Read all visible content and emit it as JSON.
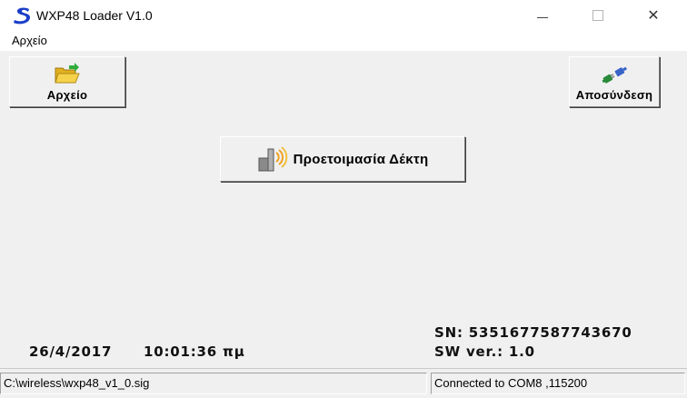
{
  "window": {
    "title": "WXP48 Loader V1.0",
    "app_icon": "s-logo-icon",
    "controls": {
      "minimize": "minimize-icon",
      "maximize": "maximize-icon",
      "close_glyph": "✕"
    }
  },
  "menu": {
    "items": [
      {
        "label": "Αρχείο"
      }
    ]
  },
  "toolbar": {
    "archive_label": "Αρχείο",
    "archive_icon": "open-folder-icon",
    "disconnect_label": "Αποσύνδεση",
    "disconnect_icon": "disconnect-plug-icon"
  },
  "main": {
    "prepare_label": "Προετοιμασία Δέκτη",
    "prepare_icon": "receiver-signal-icon"
  },
  "info": {
    "serial": "SN: 5351677587743670",
    "date": "26/4/2017",
    "time": "10:01:36 πμ",
    "sw_version": "SW ver.: 1.0"
  },
  "status": {
    "file_path": "C:\\wireless\\wxp48_v1_0.sig",
    "connection": "Connected to COM8 ,115200"
  },
  "colors": {
    "logo_blue": "#1a3ec8",
    "window_bg": "#f0f0f0",
    "titlebar_bg": "#ffffff"
  }
}
